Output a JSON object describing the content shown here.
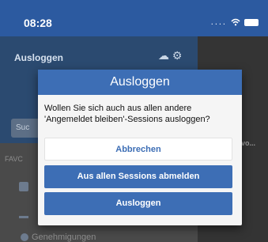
{
  "status_bar": {
    "time": "08:28",
    "signal": "....",
    "wifi_icon": "wifi-icon",
    "battery_icon": "battery-icon"
  },
  "background": {
    "header_title": "Ausloggen",
    "header_icons": "☁ ⚙",
    "search_placeholder": "Suc",
    "favorites_label": "FAVC",
    "right_text": "vo...",
    "bottom_item": "Genehmigungen"
  },
  "dialog": {
    "title": "Ausloggen",
    "message": "Wollen Sie sich auch aus allen andere 'Angemeldet bleiben'-Sessions ausloggen?",
    "buttons": {
      "cancel": "Abbrechen",
      "logout_all": "Aus allen Sessions abmelden",
      "logout": "Ausloggen"
    }
  },
  "colors": {
    "accent": "#3d6eb5",
    "status_bar": "#2c5aa0",
    "dialog_bg": "#f5f5f5"
  }
}
